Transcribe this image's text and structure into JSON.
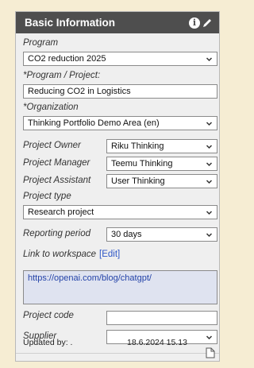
{
  "panel": {
    "title": "Basic Information",
    "icons": {
      "info": "info-icon",
      "edit": "pencil-icon",
      "document": "document-icon"
    }
  },
  "fields": {
    "program": {
      "label": "Program",
      "value": "CO2 reduction 2025"
    },
    "project": {
      "label": "*Program / Project:",
      "value": "Reducing CO2 in Logistics"
    },
    "organization": {
      "label": "*Organization",
      "value": "Thinking Portfolio Demo Area (en)"
    },
    "project_owner": {
      "label": "Project Owner",
      "value": "Riku Thinking"
    },
    "project_manager": {
      "label": "Project Manager",
      "value": "Teemu Thinking"
    },
    "project_assistant": {
      "label": "Project Assistant",
      "value": "User Thinking"
    },
    "project_type": {
      "label": "Project type",
      "value": "Research project"
    },
    "reporting_period": {
      "label": "Reporting period",
      "value": "30 days"
    },
    "workspace": {
      "label": "Link to workspace",
      "edit_label": "[Edit]",
      "url": "https://openai.com/blog/chatgpt/"
    },
    "project_code": {
      "label": "Project code",
      "value": ""
    },
    "supplier": {
      "label": "Supplier",
      "value": ""
    }
  },
  "footer": {
    "updated_label": "Updated by: .",
    "updated_value": "18.6.2024 15.13"
  }
}
